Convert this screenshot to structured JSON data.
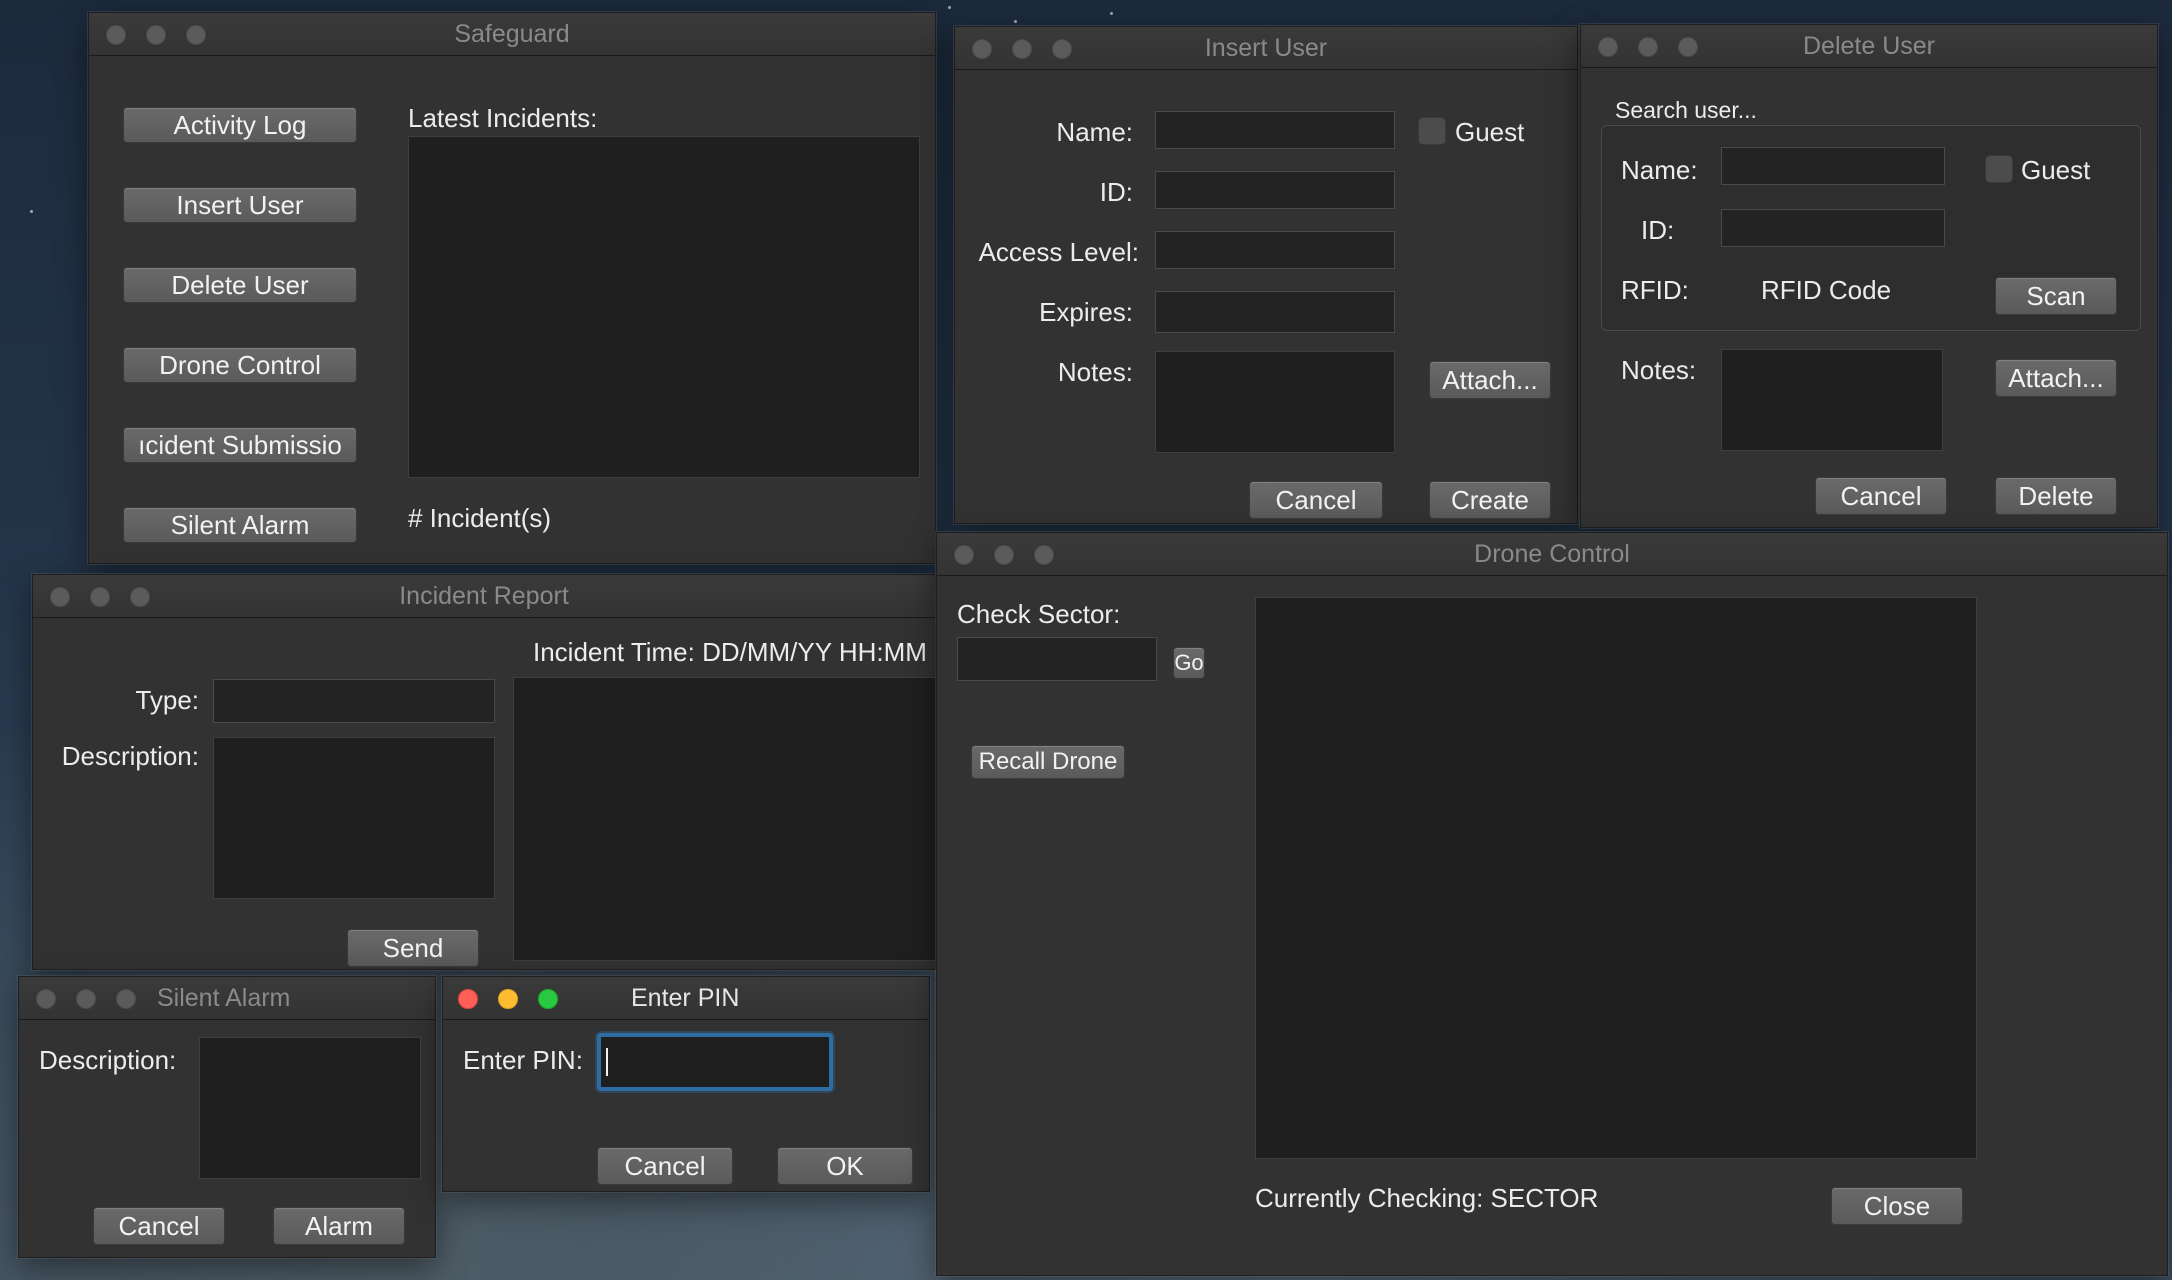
{
  "safeguard": {
    "title": "Safeguard",
    "buttons": [
      "Activity Log",
      "Insert User",
      "Delete User",
      "Drone Control",
      "ıcident Submissio",
      "Silent Alarm"
    ],
    "latest_label": "Latest Incidents:",
    "incident_count": "# Incident(s)"
  },
  "insert_user": {
    "title": "Insert User",
    "name_label": "Name:",
    "guest_label": "Guest",
    "id_label": "ID:",
    "access_label": "Access Level:",
    "expires_label": "Expires:",
    "notes_label": "Notes:",
    "attach_label": "Attach...",
    "cancel_label": "Cancel",
    "create_label": "Create"
  },
  "delete_user": {
    "title": "Delete User",
    "search_label": "Search user...",
    "name_label": "Name:",
    "guest_label": "Guest",
    "id_label": "ID:",
    "rfid_label": "RFID:",
    "rfid_value": "RFID Code",
    "scan_label": "Scan",
    "notes_label": "Notes:",
    "attach_label": "Attach...",
    "cancel_label": "Cancel",
    "delete_label": "Delete"
  },
  "incident_report": {
    "title": "Incident Report",
    "time_label": "Incident Time: DD/MM/YY HH:MM",
    "type_label": "Type:",
    "description_label": "Description:",
    "send_label": "Send"
  },
  "drone_control": {
    "title": "Drone Control",
    "check_sector_label": "Check Sector:",
    "go_label": "Go",
    "recall_label": "Recall Drone",
    "currently_checking": "Currently Checking: SECTOR",
    "close_label": "Close"
  },
  "silent_alarm": {
    "title": "Silent Alarm",
    "description_label": "Description:",
    "cancel_label": "Cancel",
    "alarm_label": "Alarm"
  },
  "enter_pin": {
    "title": "Enter PIN",
    "pin_label": "Enter PIN:",
    "cancel_label": "Cancel",
    "ok_label": "OK"
  }
}
